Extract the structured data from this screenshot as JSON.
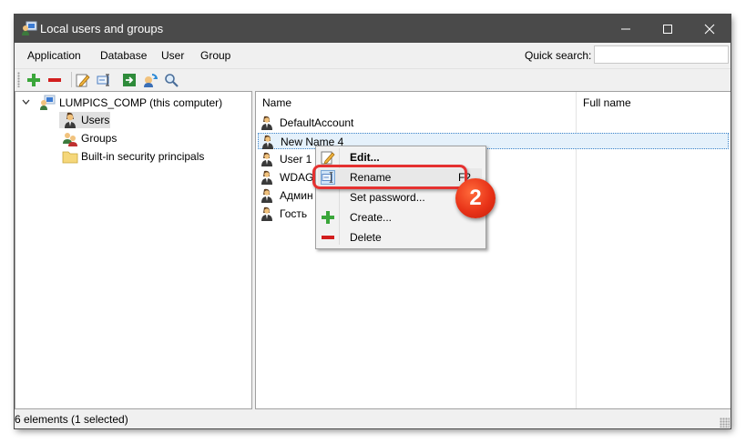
{
  "window": {
    "title": "Local users and groups"
  },
  "menu": {
    "items": [
      "Application",
      "Database",
      "User",
      "Group"
    ]
  },
  "quick_search": {
    "label": "Quick search:",
    "value": ""
  },
  "toolbar": {
    "buttons": [
      {
        "name": "add-icon"
      },
      {
        "name": "remove-icon"
      },
      {
        "name": "edit-icon"
      },
      {
        "name": "rename-icon"
      },
      {
        "name": "export-icon"
      },
      {
        "name": "refresh-icon"
      },
      {
        "name": "search-icon"
      }
    ]
  },
  "tree": {
    "root": "LUMPICS_COMP (this computer)",
    "children": [
      {
        "label": "Users",
        "selected": true
      },
      {
        "label": "Groups",
        "selected": false
      },
      {
        "label": "Built-in security principals",
        "selected": false
      }
    ]
  },
  "list": {
    "columns": [
      "Name",
      "Full name"
    ],
    "rows": [
      {
        "name": "DefaultAccount",
        "full_name": ""
      },
      {
        "name": "New Name 4",
        "full_name": "",
        "selected": true
      },
      {
        "name": "User 1",
        "full_name": ""
      },
      {
        "name": "WDAG",
        "full_name": ""
      },
      {
        "name": "Админ",
        "full_name": ""
      },
      {
        "name": "Гость",
        "full_name": ""
      }
    ]
  },
  "context_menu": {
    "items": [
      {
        "label": "Edit...",
        "icon": "edit-icon",
        "bold": true
      },
      {
        "label": "Rename",
        "shortcut": "F2",
        "icon": "rename-icon",
        "highlighted": true
      },
      {
        "label": "Set password...",
        "icon": ""
      },
      {
        "label": "Create...",
        "icon": "add-icon"
      },
      {
        "label": "Delete",
        "icon": "remove-icon"
      }
    ]
  },
  "status": {
    "text": "6 elements   (1 selected)"
  },
  "annotation": {
    "step": "2"
  },
  "colors": {
    "titlebar": "#4a4a4a",
    "callout": "#e53130",
    "selection": "#e5f1fb",
    "add_green": "#3aa63a",
    "remove_red": "#d21e1e"
  }
}
